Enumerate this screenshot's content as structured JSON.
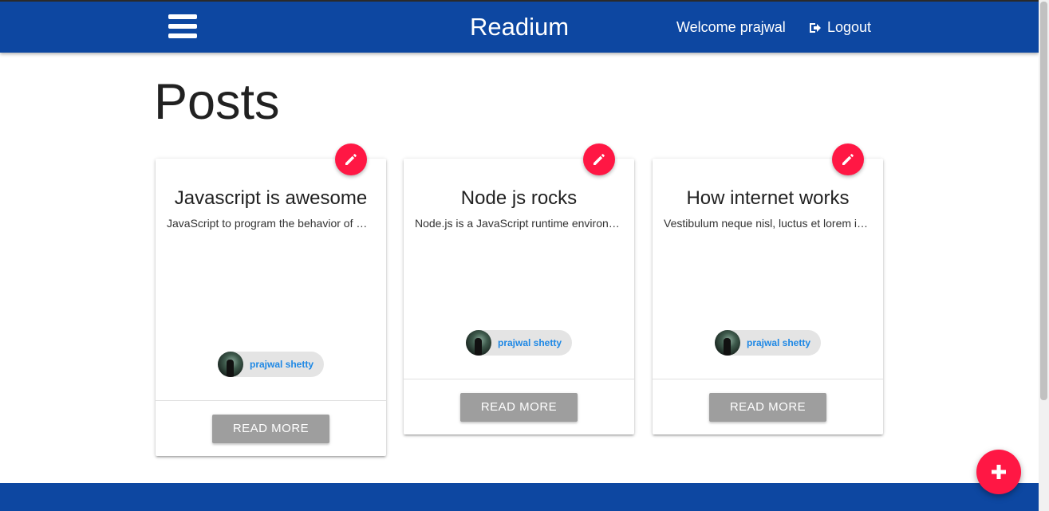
{
  "navbar": {
    "brand": "Readium",
    "welcome": "Welcome prajwal",
    "logout_label": "Logout"
  },
  "page": {
    "title": "Posts"
  },
  "posts": [
    {
      "title": "Javascript is awesome",
      "excerpt": "JavaScript to program the behavior of web pages",
      "author": "prajwal shetty",
      "button_label": "READ MORE"
    },
    {
      "title": "Node js rocks",
      "excerpt": "Node.js is a JavaScript runtime environment",
      "author": "prajwal shetty",
      "button_label": "READ MORE"
    },
    {
      "title": "How internet works",
      "excerpt": "Vestibulum neque nisl, luctus et lorem ipsum",
      "author": "prajwal shetty",
      "button_label": "READ MORE"
    }
  ],
  "icons": {
    "menu": "hamburger-menu-icon",
    "logout": "sign-out-icon",
    "edit": "pencil-icon",
    "add": "plus-icon"
  },
  "colors": {
    "primary": "#0d47a1",
    "accent": "#ff1744",
    "button": "#9e9e9e",
    "chip_text": "#1e88e5"
  }
}
